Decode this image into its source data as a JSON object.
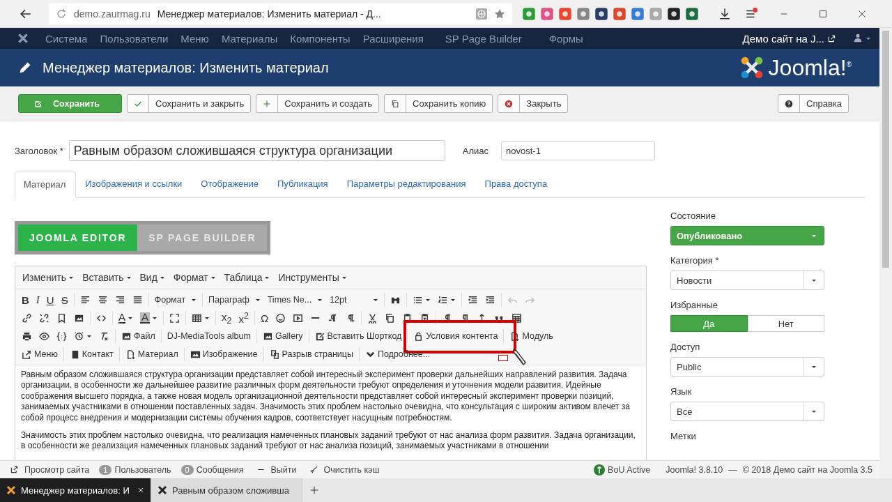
{
  "browser": {
    "url": "demo.zaurmag.ru",
    "page_title": "Менеджер материалов: Изменить материал - Д...",
    "tabs": [
      {
        "title": "Менеджер материалов: И",
        "selected": true
      },
      {
        "title": "Равным образом сложивша",
        "selected": false
      }
    ]
  },
  "admin_menu": {
    "items": [
      "Система",
      "Пользователи",
      "Меню",
      "Материалы",
      "Компоненты",
      "Расширения",
      "SP Page Builder",
      "Формы"
    ],
    "site_link": "Демо сайт на J..."
  },
  "header": {
    "title": "Менеджер материалов: Изменить материал",
    "logo": "Joomla!$^{®}$"
  },
  "toolbar": {
    "buttons": [
      {
        "label": "Сохранить",
        "kind": "primary"
      },
      {
        "label": "Сохранить и закрыть",
        "kind": "default"
      },
      {
        "label": "Сохранить и создать",
        "kind": "default"
      },
      {
        "label": "Сохранить копию",
        "kind": "default"
      },
      {
        "label": "Закрыть",
        "kind": "default"
      }
    ],
    "help": "Справка"
  },
  "form": {
    "title_label": "Заголовок *",
    "title_value": "Равным образом сложившаяся структура организации",
    "alias_label": "Алиас",
    "alias_value": "novost-1"
  },
  "tabs": [
    {
      "label": "Материал",
      "selected": true
    },
    {
      "label": "Изображения и ссылки",
      "selected": false
    },
    {
      "label": "Отображение",
      "selected": false
    },
    {
      "label": "Публикация",
      "selected": false
    },
    {
      "label": "Параметры редактирования",
      "selected": false
    },
    {
      "label": "Права доступа",
      "selected": false
    }
  ],
  "editor_switch": [
    {
      "label": "JOOMLA EDITOR",
      "selected": true
    },
    {
      "label": "SP PAGE BUILDER",
      "selected": false
    }
  ],
  "editor": {
    "menus": [
      "Изменить",
      "Вставить",
      "Вид",
      "Формат",
      "Таблица",
      "Инструменты"
    ],
    "toolbar_rows": [
      {
        "items": [
          {
            "kind": "text",
            "label": "B"
          },
          {
            "kind": "text",
            "label": "I"
          },
          {
            "kind": "text",
            "label": "U"
          },
          {
            "kind": "text",
            "label": "S"
          },
          {
            "kind": "sep"
          },
          {
            "kind": "icon"
          },
          {
            "kind": "icon"
          },
          {
            "kind": "icon"
          },
          {
            "kind": "icon"
          },
          {
            "kind": "sep"
          },
          {
            "kind": "dropdown",
            "label": "Формат"
          },
          {
            "kind": "sep"
          },
          {
            "kind": "dropdown",
            "label": "Параграф"
          },
          {
            "kind": "dropdown",
            "label": "Times Ne..."
          },
          {
            "kind": "dropdown",
            "label": "12pt"
          },
          {
            "kind": "sep"
          },
          {
            "kind": "icon"
          },
          {
            "kind": "sep"
          },
          {
            "kind": "icon"
          },
          {
            "kind": "icon"
          },
          {
            "kind": "sep"
          },
          {
            "kind": "icon"
          },
          {
            "kind": "icon"
          },
          {
            "kind": "sep"
          },
          {
            "kind": "icon"
          },
          {
            "kind": "icon"
          }
        ]
      },
      {
        "items": [
          {
            "kind": "icon"
          },
          {
            "kind": "icon"
          },
          {
            "kind": "icon"
          },
          {
            "kind": "icon"
          },
          {
            "kind": "sep"
          },
          {
            "kind": "icon"
          },
          {
            "kind": "sep"
          },
          {
            "kind": "text",
            "label": "A"
          },
          {
            "kind": "text",
            "label": "A"
          },
          {
            "kind": "sep"
          },
          {
            "kind": "icon"
          },
          {
            "kind": "sep"
          },
          {
            "kind": "icon"
          },
          {
            "kind": "sep"
          },
          {
            "kind": "text",
            "label": "x$_{2}$"
          },
          {
            "kind": "text",
            "label": "x$^{2}$"
          },
          {
            "kind": "sep"
          },
          {
            "kind": "text",
            "label": "Ω"
          },
          {
            "kind": "icon"
          },
          {
            "kind": "icon"
          },
          {
            "kind": "icon"
          },
          {
            "kind": "icon"
          },
          {
            "kind": "icon"
          },
          {
            "kind": "sep"
          },
          {
            "kind": "icon"
          },
          {
            "kind": "icon"
          },
          {
            "kind": "icon"
          },
          {
            "kind": "icon"
          },
          {
            "kind": "sep"
          },
          {
            "kind": "icon"
          },
          {
            "kind": "icon"
          },
          {
            "kind": "icon"
          },
          {
            "kind": "icon"
          },
          {
            "kind": "icon"
          }
        ]
      },
      {
        "items": [
          {
            "kind": "icon"
          },
          {
            "kind": "icon"
          },
          {
            "kind": "icon"
          },
          {
            "kind": "icon"
          },
          {
            "kind": "icon"
          },
          {
            "kind": "sep"
          },
          {
            "kind": "button",
            "label": "Файл",
            "highlighted": false
          },
          {
            "kind": "sep"
          },
          {
            "kind": "plain",
            "label": "DJ-MediaTools album",
            "highlighted": false
          },
          {
            "kind": "sep"
          },
          {
            "kind": "button",
            "label": "Gallery",
            "highlighted": false
          },
          {
            "kind": "sep"
          },
          {
            "kind": "button",
            "label": "Вставить Шорткод",
            "highlighted": false
          },
          {
            "kind": "sep"
          },
          {
            "kind": "button",
            "label": "Условия контента",
            "highlighted": true
          },
          {
            "kind": "sep"
          },
          {
            "kind": "button",
            "label": "Модуль",
            "highlighted": false
          }
        ]
      },
      {
        "items": [
          {
            "kind": "button",
            "label": "Меню"
          },
          {
            "kind": "sep"
          },
          {
            "kind": "button",
            "label": "Контакт"
          },
          {
            "kind": "sep"
          },
          {
            "kind": "button",
            "label": "Материал"
          },
          {
            "kind": "sep"
          },
          {
            "kind": "button",
            "label": "Изображение"
          },
          {
            "kind": "sep"
          },
          {
            "kind": "button",
            "label": "Разрыв страницы"
          },
          {
            "kind": "sep"
          },
          {
            "kind": "button",
            "label": "Подробнее..."
          }
        ]
      }
    ],
    "paragraphs": [
      "Равным образом сложившаяся структура организации представляет собой интересный эксперимент проверки дальнейших направлений развития. Задача организации, в особенности же дальнейшее развитие различных форм деятельности требуют определения и уточнения модели развития. Идейные соображения высшего порядка, а также новая модель организационной деятельности представляет собой интересный эксперимент проверки позиций, занимаемых участниками в отношении поставленных задач. Значимость этих проблем настолько очевидна, что консультация с широким активом влечет за собой процесс внедрения и модернизации системы обучения кадров, соответствует насущным потребностям.",
      "Значимость этих проблем настолько очевидна, что реализация намеченных плановых заданий требуют от нас анализа форм развития. Задача организации, в особенности же реализация намеченных плановых заданий требуют от нас анализа позиций, занимаемых участниками в отношении"
    ]
  },
  "sidebar": [
    {
      "kind": "status_select",
      "label": "Состояние",
      "value": "Опубликовано"
    },
    {
      "kind": "select",
      "label": "Категория *",
      "value": "Новости"
    },
    {
      "kind": "toggle",
      "label": "Избранные",
      "options": [
        {
          "label": "Да",
          "selected": true
        },
        {
          "label": "Нет",
          "selected": false
        }
      ]
    },
    {
      "kind": "select",
      "label": "Доступ",
      "value": "Public"
    },
    {
      "kind": "select",
      "label": "Язык",
      "value": "Все"
    },
    {
      "kind": "heading",
      "label": "Метки"
    }
  ],
  "status_bar": {
    "left": [
      {
        "kind": "link",
        "label": "Просмотр сайта"
      },
      {
        "kind": "badge",
        "count": "1",
        "label": "Пользователь"
      },
      {
        "kind": "badge",
        "count": "0",
        "label": "Сообщения"
      },
      {
        "kind": "logout",
        "label": "Выйти"
      },
      {
        "kind": "cache",
        "label": "Очистить кэш"
      }
    ],
    "right": [
      {
        "kind": "active",
        "label": "BoU Active"
      },
      {
        "kind": "text",
        "label": "Joomla! 3.8.10"
      },
      {
        "kind": "text",
        "label": "—"
      },
      {
        "kind": "text",
        "label": "© 2018 Демо сайт на Joomla 3.5"
      }
    ]
  }
}
